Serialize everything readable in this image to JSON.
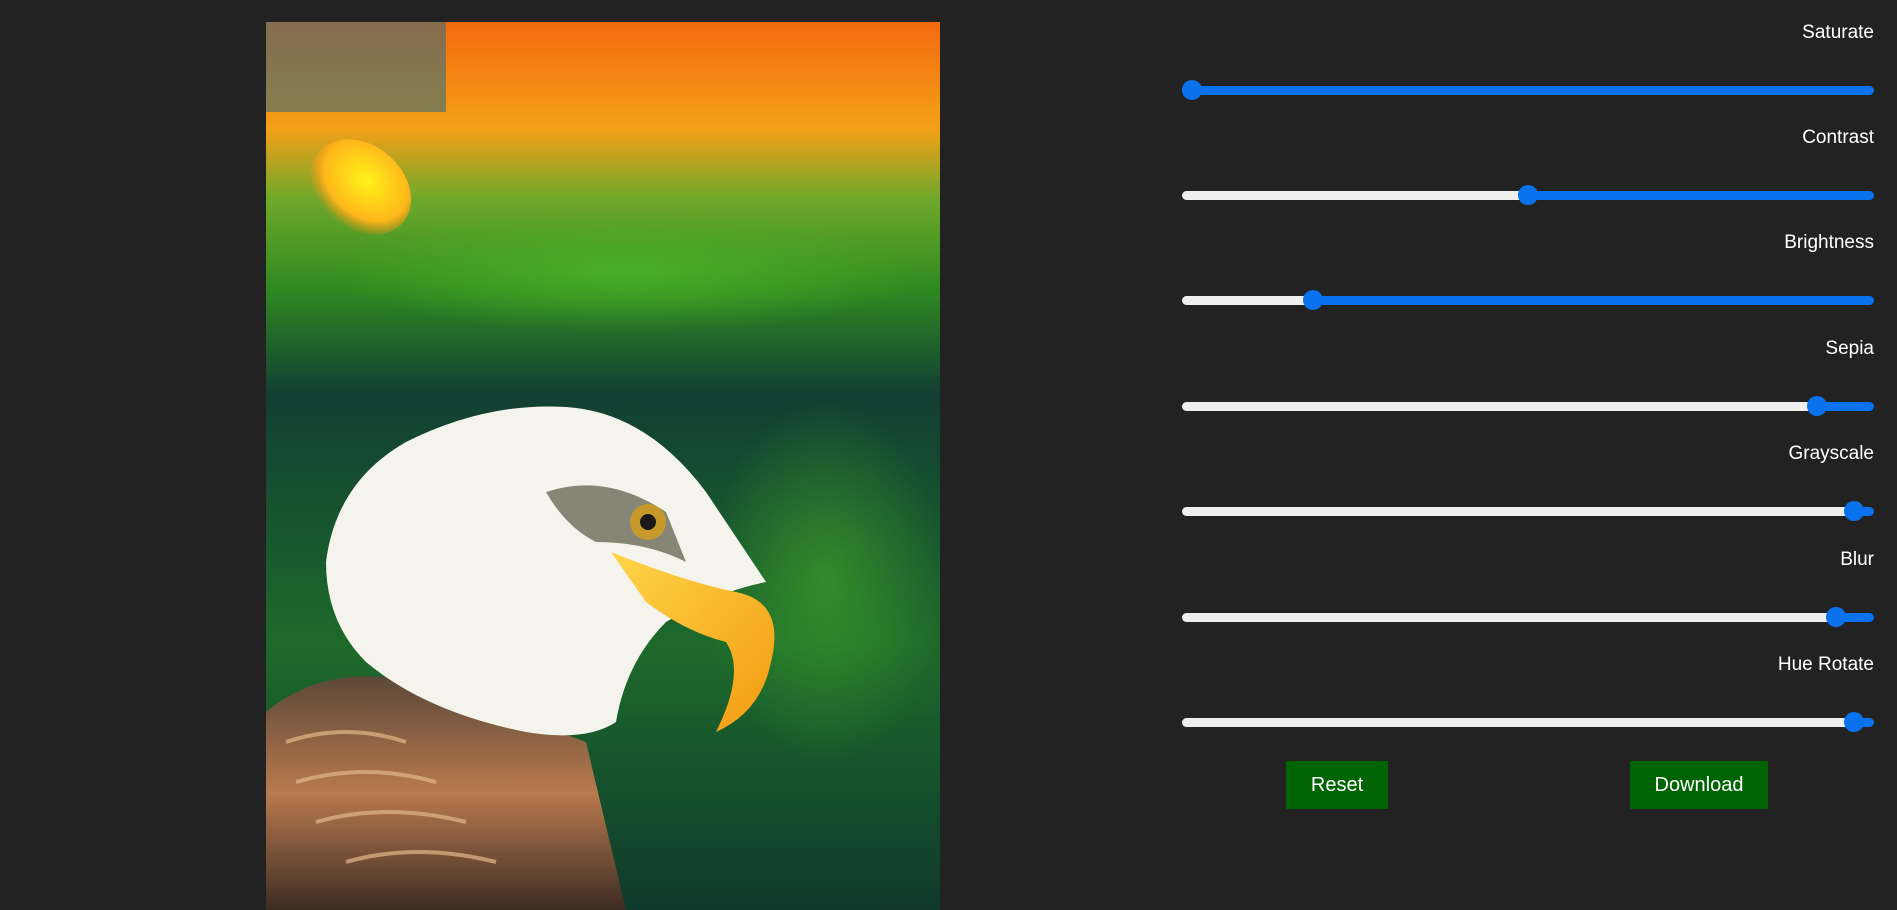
{
  "image": {
    "subject": "bald eagle portrait with colorful filtered background"
  },
  "controls": [
    {
      "label": "Saturate",
      "level": 0.0
    },
    {
      "label": "Contrast",
      "level": 0.5
    },
    {
      "label": "Brightness",
      "level": 0.18
    },
    {
      "label": "Sepia",
      "level": 0.93
    },
    {
      "label": "Grayscale",
      "level": 0.985
    },
    {
      "label": "Blur",
      "level": 0.958
    },
    {
      "label": "Hue Rotate",
      "level": 0.985
    }
  ],
  "buttons": {
    "reset": "Reset",
    "download": "Download"
  },
  "colors": {
    "accent": "#0b72ee",
    "button": "#016403",
    "background": "#222222",
    "track": "#efefef"
  }
}
